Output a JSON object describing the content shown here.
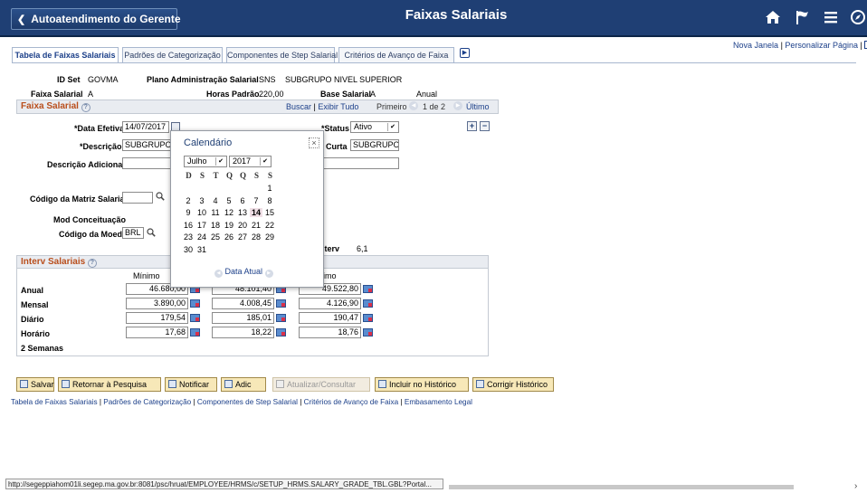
{
  "header": {
    "back_label": "Autoatendimento do Gerente",
    "title": "Faixas Salariais"
  },
  "topright": {
    "new_window": "Nova Janela",
    "personalize": "Personalizar Página"
  },
  "tabs": [
    {
      "label": "Tabela de Faixas Salariais"
    },
    {
      "label": "Padrões de Categorização"
    },
    {
      "label": "Componentes de Step Salarial"
    },
    {
      "label": "Critérios de Avanço de Faixa"
    }
  ],
  "summary": {
    "setid_label": "ID Set",
    "setid_value": "GOVMA",
    "plan_label": "Plano Administração Salarial",
    "plan_value": "SNS",
    "plan_desc": "SUBGRUPO NIVEL SUPERIOR",
    "grade_label": "Faixa Salarial",
    "grade_value": "A",
    "hours_label": "Horas Padrão",
    "hours_value": "220,00",
    "base_label": "Base Salarial",
    "base_value": "A",
    "base_freq": "Anual"
  },
  "faixa_section": {
    "title": "Faixa Salarial",
    "find": "Buscar",
    "view_all": "Exibir Tudo",
    "first": "Primeiro",
    "counter": "1 de 2",
    "last": "Último",
    "eff_date_label": "*Data Efetiva",
    "eff_date_value": "14/07/2017",
    "status_label": "*Status",
    "status_value": "Ativo",
    "desc_label": "*Descrição",
    "desc_value": "SUBGRUPO",
    "short_label": "Curta",
    "short_value": "SUBGRUPO N",
    "add_desc_label": "Descrição Adicional",
    "matrix_label": "Código da Matriz Salarial",
    "mod_label": "Mod Conceituação",
    "currency_label": "Código da Moeda",
    "currency_value": "BRL",
    "interv_label": "iterv",
    "interv_value": "6,1"
  },
  "calendar": {
    "title": "Calendário",
    "month": "Julho",
    "year": "2017",
    "weekdays": [
      "D",
      "S",
      "T",
      "Q",
      "Q",
      "S",
      "S"
    ],
    "weeks": [
      [
        "",
        "",
        "",
        "",
        "",
        "",
        "1"
      ],
      [
        "2",
        "3",
        "4",
        "5",
        "6",
        "7",
        "8"
      ],
      [
        "9",
        "10",
        "11",
        "12",
        "13",
        "14",
        "15"
      ],
      [
        "16",
        "17",
        "18",
        "19",
        "20",
        "21",
        "22"
      ],
      [
        "23",
        "24",
        "25",
        "26",
        "27",
        "28",
        "29"
      ],
      [
        "30",
        "31",
        "",
        "",
        "",
        "",
        ""
      ]
    ],
    "selected_day": "14",
    "today_label": "Data Atual"
  },
  "interv": {
    "title": "Interv Salariais",
    "col_min": "Mínimo",
    "col_max": "imo",
    "rows": [
      {
        "label": "Anual",
        "min": "46.680,00",
        "mid": "48.101,40",
        "max": "49.522,80"
      },
      {
        "label": "Mensal",
        "min": "3.890,00",
        "mid": "4.008,45",
        "max": "4.126,90"
      },
      {
        "label": "Diário",
        "min": "179,54",
        "mid": "185,01",
        "max": "190,47"
      },
      {
        "label": "Horário",
        "min": "17,68",
        "mid": "18,22",
        "max": "18,76"
      },
      {
        "label": "2 Semanas",
        "min": "",
        "mid": "",
        "max": ""
      }
    ]
  },
  "buttons": {
    "save": "Salvar",
    "return": "Retornar à Pesquisa",
    "notify": "Notificar",
    "add": "Adic",
    "update": "Atualizar/Consultar",
    "include_history": "Incluir no Histórico",
    "correct_history": "Corrigir Histórico"
  },
  "footer_links": [
    {
      "label": "Tabela de Faixas Salariais"
    },
    {
      "label": "Padrões de Categorização"
    },
    {
      "label": "Componentes de Step Salarial"
    },
    {
      "label": "Critérios de Avanço de Faixa"
    },
    {
      "label": "Embasamento Legal"
    }
  ],
  "status_url": "http://segeppiahom01li.segep.ma.gov.br:8081/psc/hruat/EMPLOYEE/HRMS/c/SETUP_HRMS.SALARY_GRADE_TBL.GBL?Portal..."
}
